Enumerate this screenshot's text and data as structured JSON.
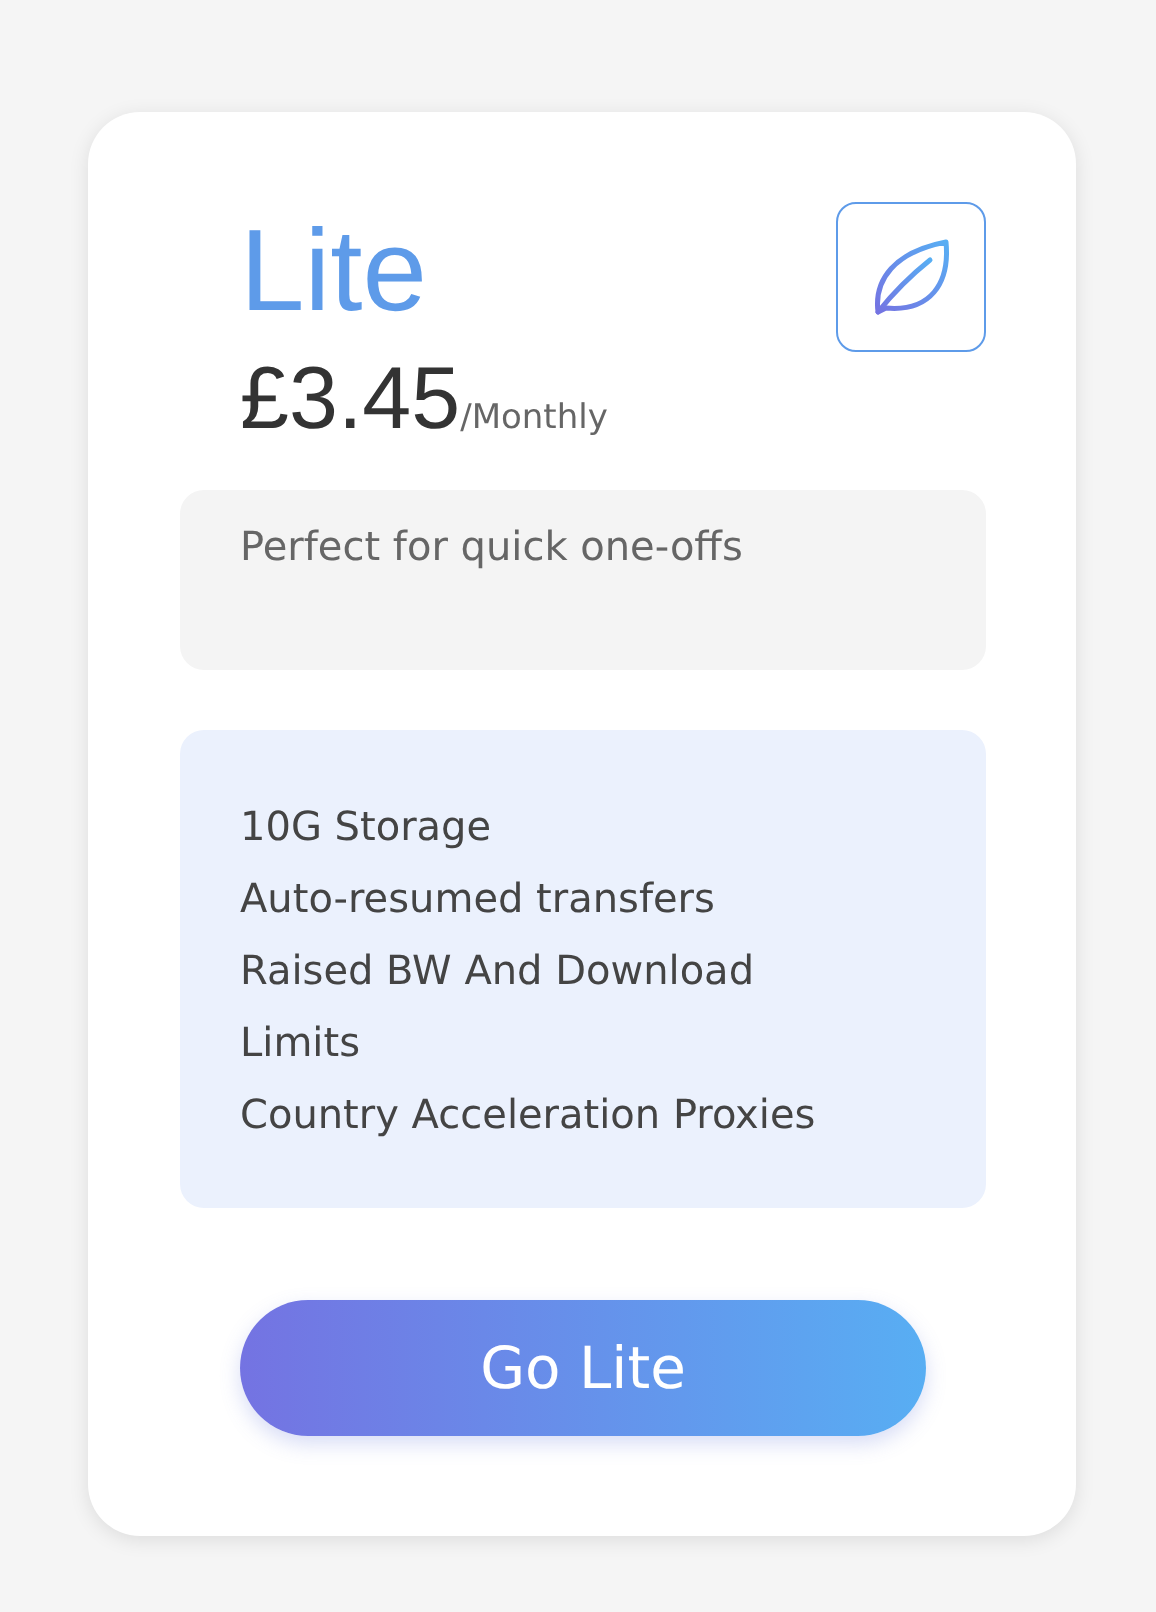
{
  "plan": {
    "name": "Lite",
    "price": "£3.45",
    "period": "/Monthly",
    "description": "Perfect for quick one-offs",
    "features": [
      "10G Storage",
      "Auto-resumed transfers",
      "Raised BW And Download Limits",
      "Country Acceleration Proxies"
    ],
    "button": "Go Lite"
  }
}
